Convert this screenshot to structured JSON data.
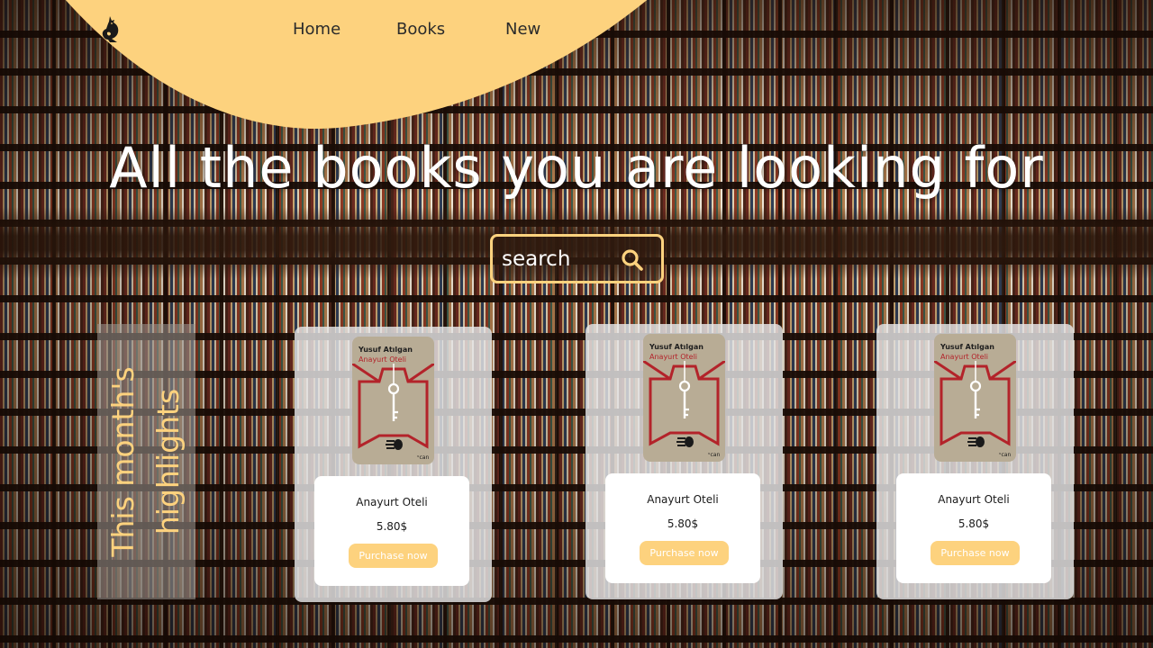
{
  "nav": {
    "items": [
      {
        "label": "Home"
      },
      {
        "label": "Books"
      },
      {
        "label": "New"
      }
    ]
  },
  "hero": {
    "title": "All the books you are looking for"
  },
  "search": {
    "placeholder": "search",
    "value": ""
  },
  "highlights": {
    "title": "This month's highlights"
  },
  "books": [
    {
      "cover_author": "Yusuf Atılgan",
      "cover_title": "Anayurt Oteli",
      "name": "Anayurt Oteli",
      "price": "5.80$",
      "button": "Purchase now"
    },
    {
      "cover_author": "Yusuf Atılgan",
      "cover_title": "Anayurt Oteli",
      "name": "Anayurt Oteli",
      "price": "5.80$",
      "button": "Purchase now"
    },
    {
      "cover_author": "Yusuf Atılgan",
      "cover_title": "Anayurt Oteli",
      "name": "Anayurt Oteli",
      "price": "5.80$",
      "button": "Purchase now"
    }
  ],
  "colors": {
    "accent": "#fdd27e",
    "cover_red": "#b3232a",
    "cover_bg": "#b8ac95"
  },
  "icons": {
    "logo": "kangaroo-logo-icon",
    "search": "magnifier-icon"
  }
}
